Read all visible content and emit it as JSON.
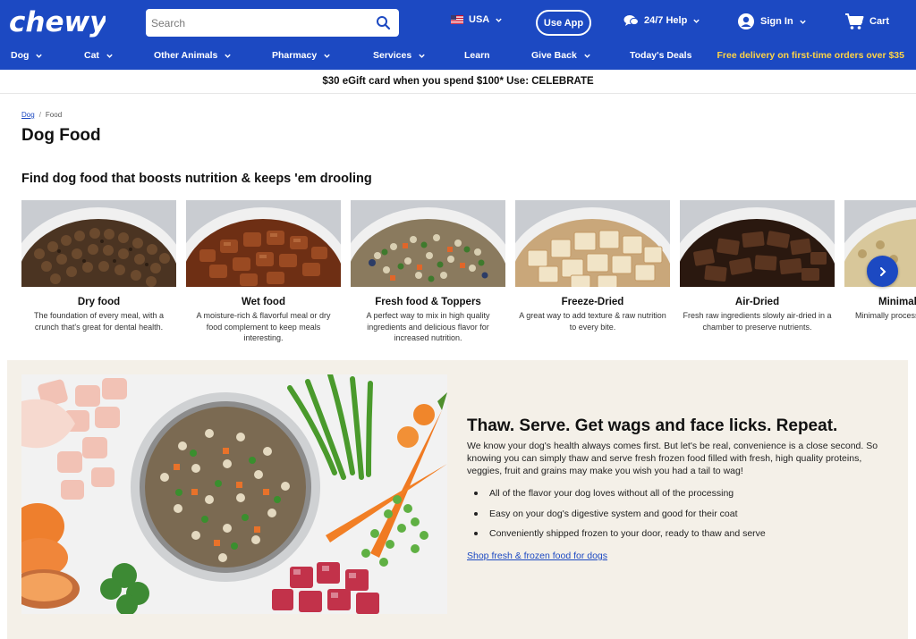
{
  "header": {
    "logo_text": "chewy",
    "search": {
      "placeholder": "Search"
    },
    "country": "USA",
    "use_app": "Use App",
    "help": "24/7 Help",
    "sign_in": "Sign In",
    "cart": "Cart",
    "brand_color": "#1c49c2",
    "highlight_color": "#ffd445"
  },
  "nav": {
    "items": [
      {
        "label": "Dog",
        "dropdown": true
      },
      {
        "label": "Cat",
        "dropdown": true
      },
      {
        "label": "Other Animals",
        "dropdown": true
      },
      {
        "label": "Pharmacy",
        "dropdown": true
      },
      {
        "label": "Services",
        "dropdown": true
      },
      {
        "label": "Learn",
        "dropdown": false
      },
      {
        "label": "Give Back",
        "dropdown": true
      },
      {
        "label": "Today's Deals",
        "dropdown": false
      }
    ],
    "free_delivery": "Free delivery on first-time orders over $35"
  },
  "promo": "$30 eGift card when you spend $100* Use: CELEBRATE",
  "breadcrumb": {
    "parent": "Dog",
    "separator": "/",
    "current": "Food"
  },
  "page_title": "Dog Food",
  "section_title": "Find dog food that boosts nutrition & keeps 'em drooling",
  "cards": [
    {
      "name": "Dry food",
      "desc": "The foundation of every meal, with a crunch that's great for dental health."
    },
    {
      "name": "Wet food",
      "desc": "A moisture-rich & flavorful meal or dry food complement to keep meals interesting."
    },
    {
      "name": "Fresh food & Toppers",
      "desc": "A perfect way to mix in high quality ingredients and delicious flavor for increased nutrition."
    },
    {
      "name": "Freeze-Dried",
      "desc": "A great way to add texture & raw nutrition to every bite."
    },
    {
      "name": "Air-Dried",
      "desc": "Fresh raw ingredients slowly air-dried in a chamber to preserve nutrients."
    },
    {
      "name": "Minimally processed",
      "desc": "Minimally processed nutrients."
    }
  ],
  "feature": {
    "title": "Thaw. Serve. Get wags and face licks. Repeat.",
    "body": "We know your dog's health always comes first. But let's be real, convenience is a close second. So knowing you can simply thaw and serve fresh frozen food filled with fresh, high quality proteins, veggies, fruit and grains may make you wish you had a tail to wag!",
    "bullets": [
      "All of the flavor your dog loves without all of the processing",
      "Easy on your dog's digestive system and good for their coat",
      "Conveniently shipped frozen to your door, ready to thaw and serve"
    ],
    "link": "Shop fresh & frozen food for dogs",
    "background_color": "#f4f0e8"
  }
}
